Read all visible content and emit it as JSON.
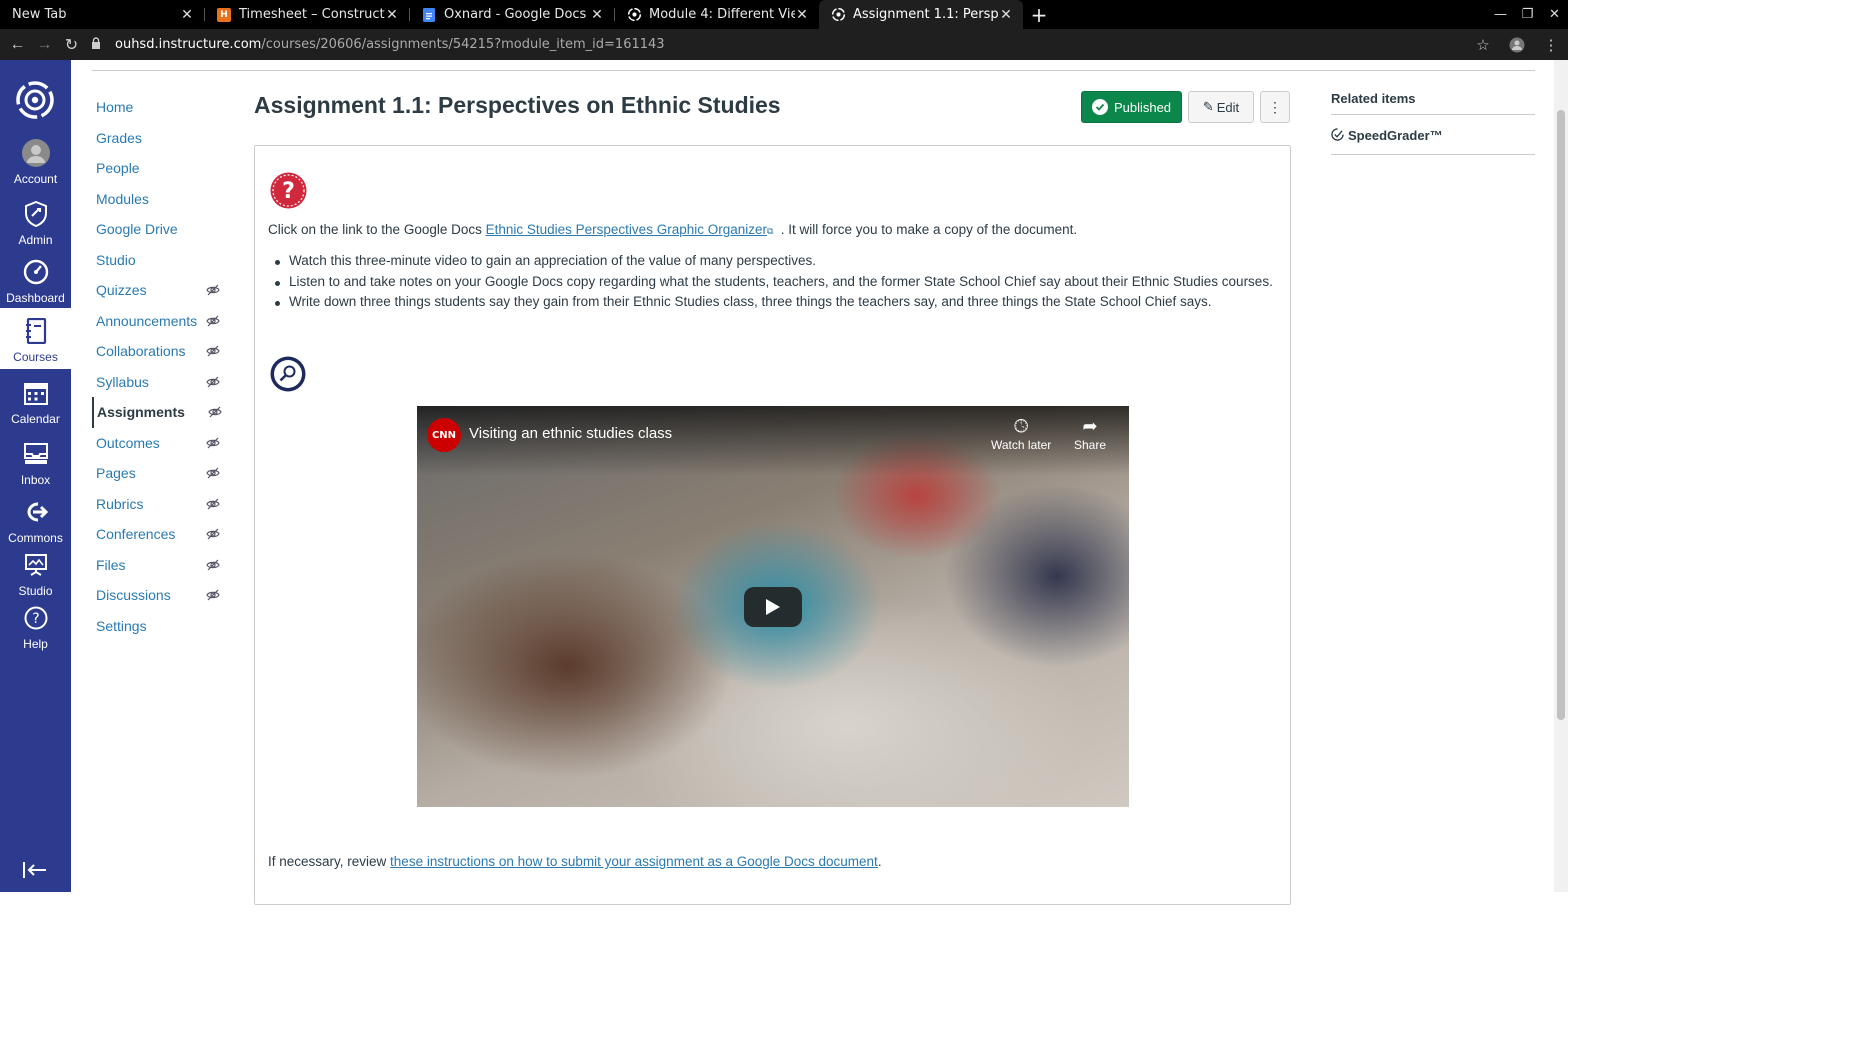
{
  "browser": {
    "tabs": [
      {
        "title": "New Tab",
        "favicon": "none",
        "active": false
      },
      {
        "title": "Timesheet – Construct Ed",
        "favicon": "H",
        "active": false
      },
      {
        "title": "Oxnard - Google Docs",
        "favicon": "docs",
        "active": false
      },
      {
        "title": "Module 4: Different Views",
        "favicon": "canvas",
        "active": false
      },
      {
        "title": "Assignment 1.1: Perspecti",
        "favicon": "canvas",
        "active": true
      }
    ],
    "url_host": "ouhsd.instructure.com",
    "url_path": "/courses/20606/assignments/54215?module_item_id=161143"
  },
  "global_nav": {
    "items": [
      {
        "label": "Account"
      },
      {
        "label": "Admin"
      },
      {
        "label": "Dashboard"
      },
      {
        "label": "Courses"
      },
      {
        "label": "Calendar"
      },
      {
        "label": "Inbox"
      },
      {
        "label": "Commons"
      },
      {
        "label": "Studio"
      },
      {
        "label": "Help"
      }
    ]
  },
  "course_nav": {
    "items": [
      {
        "label": "Home",
        "hidden": false
      },
      {
        "label": "Grades",
        "hidden": false
      },
      {
        "label": "People",
        "hidden": false
      },
      {
        "label": "Modules",
        "hidden": false
      },
      {
        "label": "Google Drive",
        "hidden": false
      },
      {
        "label": "Studio",
        "hidden": false
      },
      {
        "label": "Quizzes",
        "hidden": true
      },
      {
        "label": "Announcements",
        "hidden": true
      },
      {
        "label": "Collaborations",
        "hidden": true
      },
      {
        "label": "Syllabus",
        "hidden": true
      },
      {
        "label": "Assignments",
        "hidden": true,
        "active": true
      },
      {
        "label": "Outcomes",
        "hidden": true
      },
      {
        "label": "Pages",
        "hidden": true
      },
      {
        "label": "Rubrics",
        "hidden": true
      },
      {
        "label": "Conferences",
        "hidden": true
      },
      {
        "label": "Files",
        "hidden": true
      },
      {
        "label": "Discussions",
        "hidden": true
      },
      {
        "label": "Settings",
        "hidden": false
      }
    ]
  },
  "assignment": {
    "title": "Assignment 1.1: Perspectives on Ethnic Studies",
    "published_label": "Published",
    "edit_label": "Edit",
    "intro_before": "Click on the link to the Google Docs ",
    "intro_link": "Ethnic Studies Perspectives Graphic Organizer",
    "intro_after": " . It will force you to make a copy of the document.",
    "bullets": [
      "Watch this three-minute video to gain an appreciation of the value of many perspectives.",
      "Listen to and take notes on your Google Docs copy regarding what the students, teachers, and the former State School Chief say about their Ethnic Studies courses.",
      "Write down three things students say they gain from their Ethnic Studies class, three things the teachers say, and three things the State School Chief says."
    ],
    "video": {
      "channel_logo": "CNN",
      "title": "Visiting an ethnic studies class",
      "watch_later": "Watch later",
      "share": "Share"
    },
    "footer_before": "If necessary, review ",
    "footer_link": "these instructions on how to submit your assignment as a Google Docs document",
    "footer_after": "."
  },
  "sidebar": {
    "heading": "Related items",
    "speedgrader": "SpeedGrader™"
  },
  "colors": {
    "global_nav_bg": "#2d3b8f",
    "link": "#2a7ab0",
    "published": "#0b874b",
    "question_icon": "#d0283c"
  }
}
